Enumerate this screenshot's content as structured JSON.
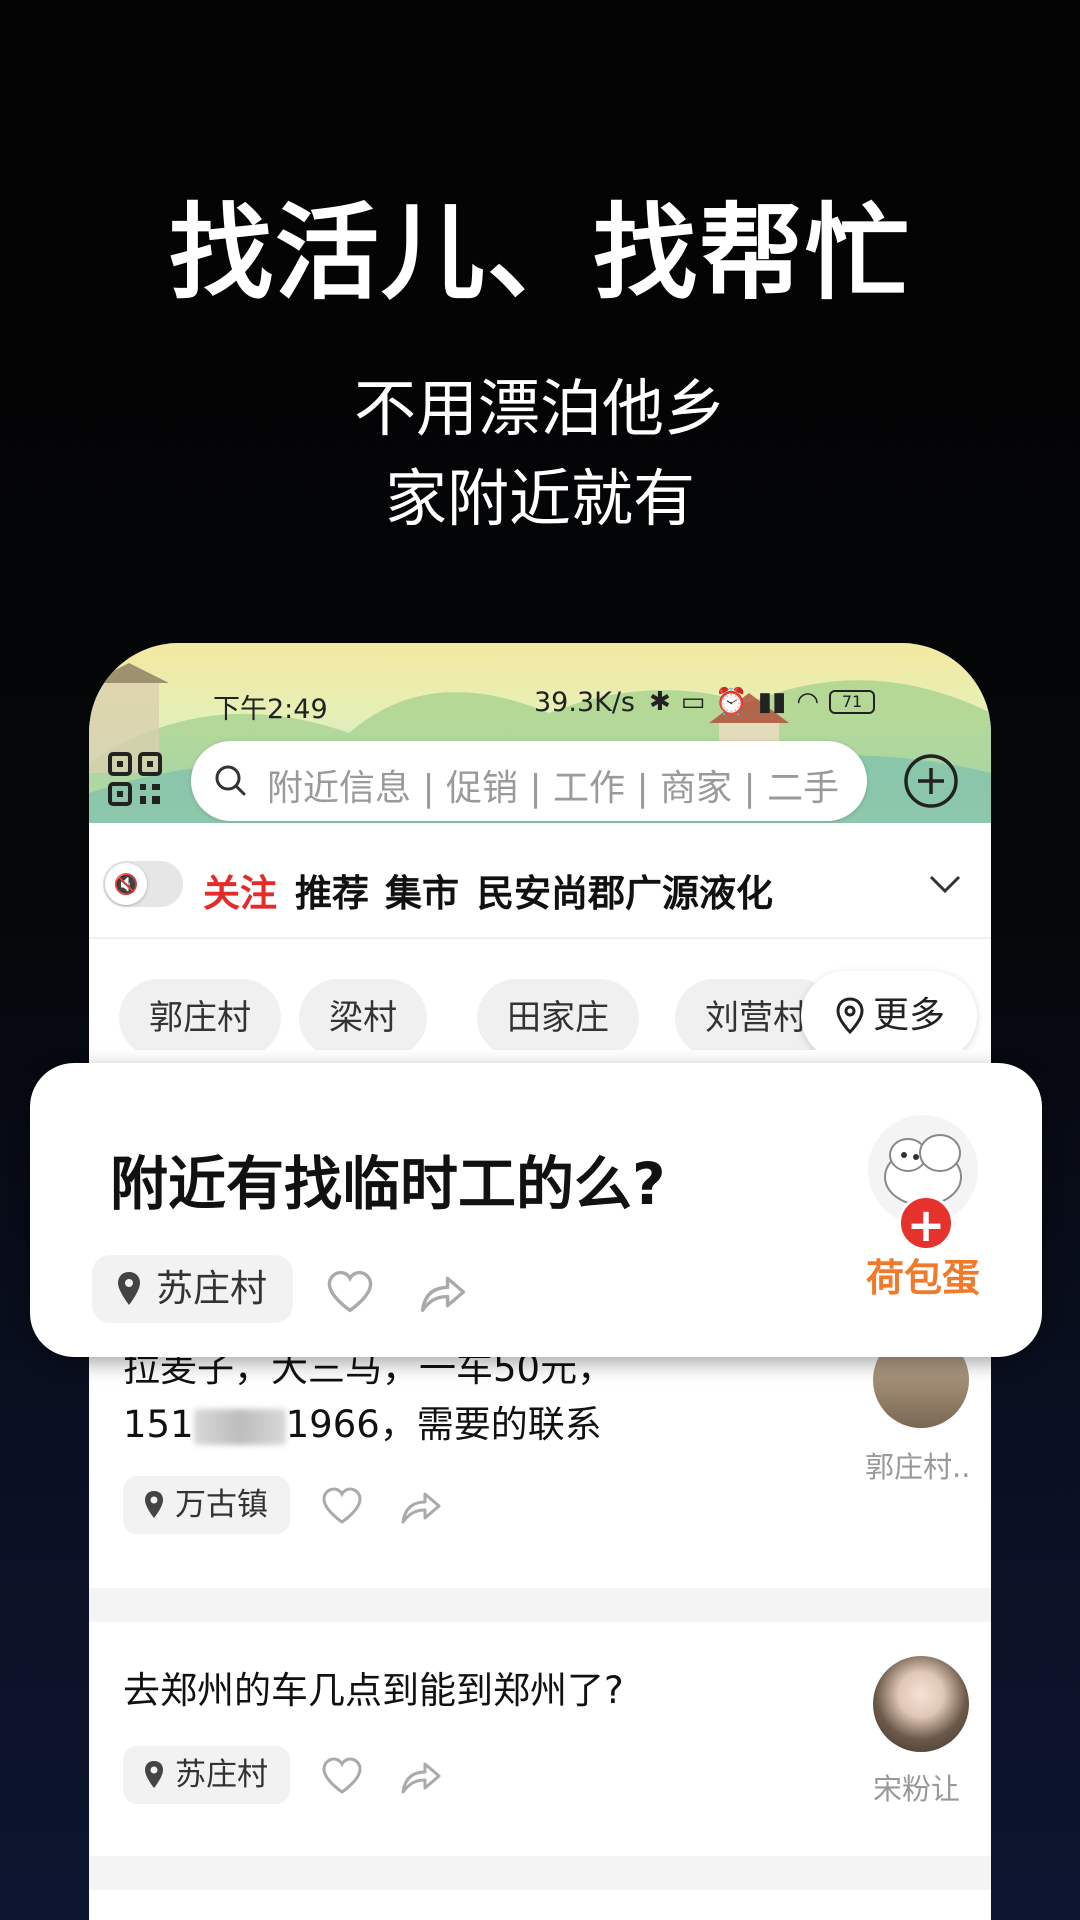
{
  "promo": {
    "headline": "找活儿、找帮忙",
    "line1": "不用漂泊他乡",
    "line2": "家附近就有"
  },
  "status_bar": {
    "time": "下午2:49",
    "speed": "39.3K/s",
    "battery": "71"
  },
  "search": {
    "placeholder": "附近信息 | 促销 | 工作 | 商家 | 二手"
  },
  "tabs": [
    {
      "label": "关注",
      "active": true
    },
    {
      "label": "推荐",
      "active": false
    },
    {
      "label": "集市",
      "active": false
    },
    {
      "label": "民安尚郡",
      "active": false
    },
    {
      "label": "广源液化",
      "active": false
    }
  ],
  "filters": {
    "chips": [
      "郭庄村",
      "梁村",
      "田家庄",
      "刘营村"
    ],
    "more_label": "更多"
  },
  "highlight_card": {
    "title": "附近有找临时工的么?",
    "location": "苏庄村",
    "username": "荷包蛋"
  },
  "posts": [
    {
      "line1": "拉麦子，大三马，一车50元，",
      "line2_prefix": "151",
      "line2_suffix": "1966，需要的联系",
      "location": "万古镇",
      "username": "郭庄村.."
    },
    {
      "line1": "去郑州的车几点到能到郑州了?",
      "location": "苏庄村",
      "username": "宋粉让"
    }
  ],
  "colors": {
    "accent_red": "#e52a2a",
    "username_orange": "#f0792a"
  },
  "icons": [
    "qr-code-icon",
    "search-icon",
    "add-icon",
    "mute-icon",
    "chevron-down-icon",
    "location-pin-icon",
    "heart-icon",
    "share-icon"
  ]
}
